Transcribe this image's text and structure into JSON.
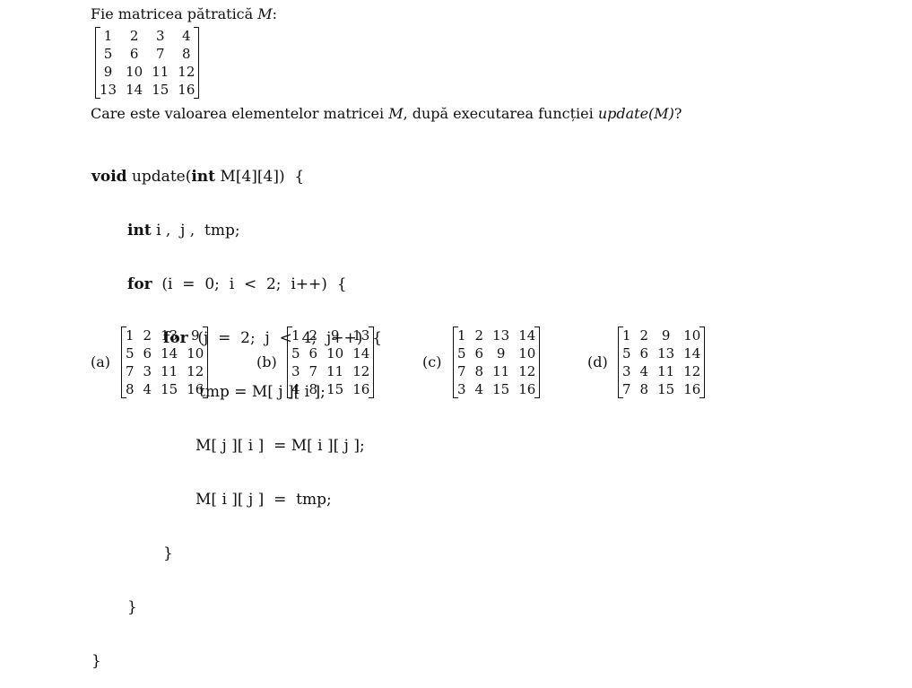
{
  "intro": {
    "text": "Fie matricea pătratică ",
    "var": "M",
    "colon": ":"
  },
  "matrix_M": [
    [
      "1",
      "2",
      "3",
      "4"
    ],
    [
      "5",
      "6",
      "7",
      "8"
    ],
    [
      "9",
      "10",
      "11",
      "12"
    ],
    [
      "13",
      "14",
      "15",
      "16"
    ]
  ],
  "question": {
    "part1": "Care este valoarea elementelor matricei ",
    "var": "M",
    "part2": ", după executarea funcției ",
    "func": "update(M)",
    "part3": "?"
  },
  "code": {
    "l1_kw": "void",
    "l1_a": " update(",
    "l1_kw2": "int",
    "l1_b": " M[4][4])  {",
    "l2_kw": "int",
    "l2_rest": " i ,  j ,  tmp;",
    "l3_kw": "for",
    "l3_rest": "  (i  =  0;  i  <  2;  i++)  {",
    "l4_kw": "for",
    "l4_rest": "  (j  =  2;  j  <  4;  j++)  {",
    "l5": "tmp = M[ j ][ i ];",
    "l6": "M[ j ][ i ]  = M[ i ][ j ];",
    "l7": "M[ i ][ j ]  =  tmp;",
    "l8": "}",
    "l9": "}",
    "l10": "}"
  },
  "options": [
    {
      "label": "(a)",
      "rows": [
        [
          "1",
          "2",
          "13",
          "9"
        ],
        [
          "5",
          "6",
          "14",
          "10"
        ],
        [
          "7",
          "3",
          "11",
          "12"
        ],
        [
          "8",
          "4",
          "15",
          "16"
        ]
      ]
    },
    {
      "label": "(b)",
      "rows": [
        [
          "1",
          "2",
          "9",
          "13"
        ],
        [
          "5",
          "6",
          "10",
          "14"
        ],
        [
          "3",
          "7",
          "11",
          "12"
        ],
        [
          "4",
          "8",
          "15",
          "16"
        ]
      ]
    },
    {
      "label": "(c)",
      "rows": [
        [
          "1",
          "2",
          "13",
          "14"
        ],
        [
          "5",
          "6",
          "9",
          "10"
        ],
        [
          "7",
          "8",
          "11",
          "12"
        ],
        [
          "3",
          "4",
          "15",
          "16"
        ]
      ]
    },
    {
      "label": "(d)",
      "rows": [
        [
          "1",
          "2",
          "9",
          "10"
        ],
        [
          "5",
          "6",
          "13",
          "14"
        ],
        [
          "3",
          "4",
          "11",
          "12"
        ],
        [
          "7",
          "8",
          "15",
          "16"
        ]
      ]
    }
  ]
}
